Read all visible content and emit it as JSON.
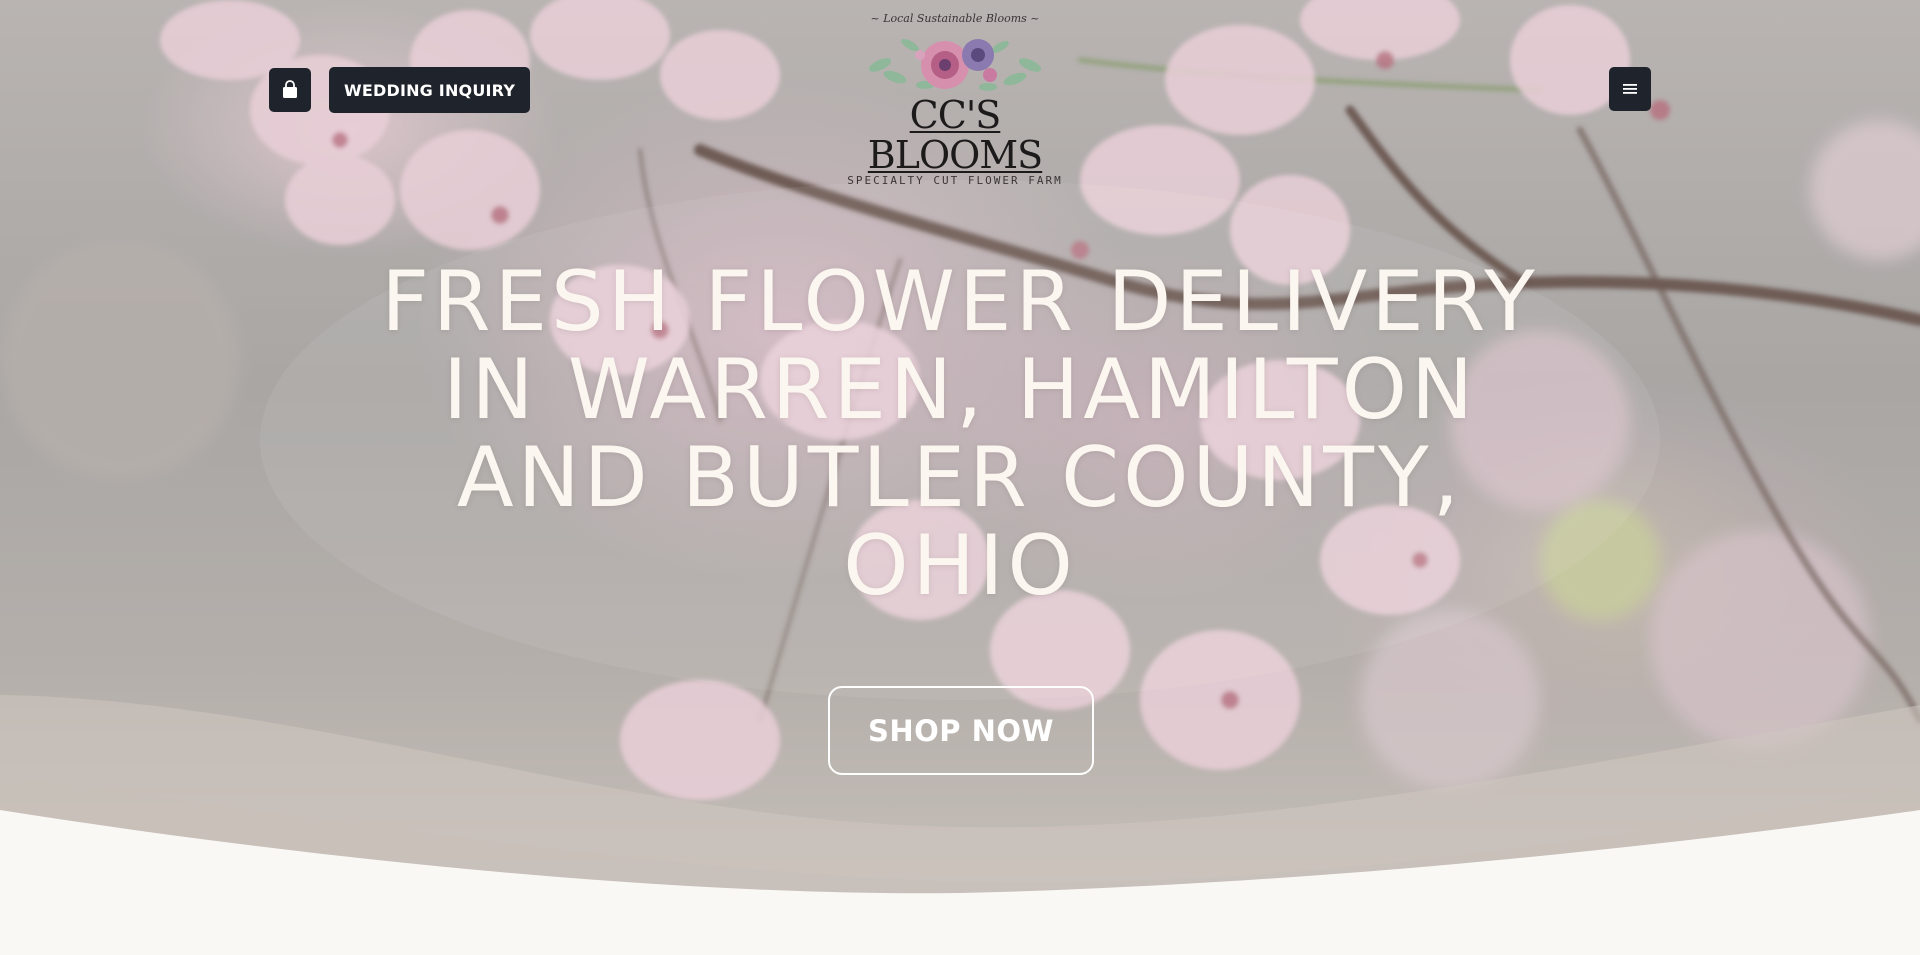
{
  "header": {
    "cart_icon": "shopping-bag-icon",
    "inquiry_label": "WEDDING INQUIRY",
    "menu_icon": "hamburger-menu-icon"
  },
  "logo": {
    "tagline": "~ Local Sustainable Blooms ~",
    "title": "CC'S BLOOMS",
    "subtitle": "SPECIALTY CUT FLOWER FARM"
  },
  "hero": {
    "headline": "FRESH FLOWER DELIVERY IN WARREN, HAMILTON AND BUTLER COUNTY, OHIO",
    "cta_label": "SHOP NOW"
  },
  "colors": {
    "button_dark": "#1f232b",
    "headline": "#fbf7f0",
    "page_bottom": "#faf8f5"
  }
}
